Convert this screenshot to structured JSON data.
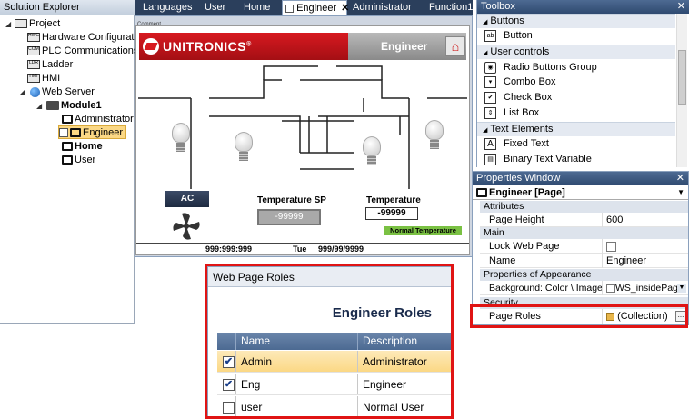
{
  "solution_explorer": {
    "title": "Solution Explorer",
    "items": [
      {
        "label": "Project",
        "icon": "project-icon"
      },
      {
        "label": "Hardware Configuratio",
        "icon": "hardware-config-icon"
      },
      {
        "label": "PLC Communications",
        "icon": "plc-comm-icon"
      },
      {
        "label": "Ladder",
        "icon": "ladder-icon"
      },
      {
        "label": "HMI",
        "icon": "hmi-icon"
      },
      {
        "label": "Web Server",
        "icon": "globe-icon"
      },
      {
        "label": "Module1",
        "icon": "folder-icon"
      },
      {
        "label": "Administrator",
        "icon": "monitor-icon"
      },
      {
        "label": "Engineer",
        "icon": "monitor-icon"
      },
      {
        "label": "Home",
        "icon": "monitor-icon"
      },
      {
        "label": "User",
        "icon": "monitor-icon"
      }
    ],
    "icon_text": {
      "hw": "HWC",
      "plc": "COM",
      "ladder": "LDR",
      "hmi": "HMI"
    }
  },
  "tabs": [
    {
      "label": "Languages"
    },
    {
      "label": "User"
    },
    {
      "label": "Home"
    },
    {
      "label": "Engineer",
      "active": true
    },
    {
      "label": "Administrator"
    },
    {
      "label": "Function1"
    }
  ],
  "designer": {
    "comment_label": "Comment",
    "brand": "UNITRONICS",
    "brand_mark": "®",
    "page_title": "Engineer",
    "ac_button": "AC",
    "temp_sp_label": "Temperature SP",
    "temp_sp_value": "-99999",
    "temp_label": "Temperature",
    "temp_value": "-99999",
    "normal_temp": "Normal Temperature",
    "status_time": "999:999:999",
    "status_day": "Tue",
    "status_date": "999/99/9999"
  },
  "toolbox": {
    "title": "Toolbox",
    "categories": [
      {
        "label": "Buttons",
        "items": [
          {
            "label": "Button",
            "icon": "button-icon",
            "glyph": "ab"
          }
        ]
      },
      {
        "label": "User controls",
        "items": [
          {
            "label": "Radio Buttons Group",
            "icon": "radio-group-icon"
          },
          {
            "label": "Combo Box",
            "icon": "combo-box-icon"
          },
          {
            "label": "Check Box",
            "icon": "check-box-icon"
          },
          {
            "label": "List Box",
            "icon": "list-box-icon"
          }
        ]
      },
      {
        "label": "Text Elements",
        "items": [
          {
            "label": "Fixed Text",
            "icon": "fixed-text-icon",
            "glyph": "A"
          },
          {
            "label": "Binary Text Variable",
            "icon": "binary-text-icon"
          }
        ]
      }
    ]
  },
  "properties": {
    "title": "Properties Window",
    "selected": "Engineer [Page]",
    "categories": {
      "attributes": "Attributes",
      "main": "Main",
      "appearance": "Properties of Appearance",
      "security": "Security"
    },
    "rows": {
      "page_height": {
        "name": "Page Height",
        "value": "600"
      },
      "lock_web_page": {
        "name": "Lock Web Page",
        "value": false
      },
      "name": {
        "name": "Name",
        "value": "Engineer"
      },
      "background": {
        "name": "Background: Color \\ Image",
        "value": "WS_insidePage"
      },
      "page_roles": {
        "name": "Page Roles",
        "value": "(Collection)",
        "button": "..."
      }
    }
  },
  "roles_dialog": {
    "title": "Web Page Roles",
    "heading": "Engineer Roles",
    "columns": [
      "Name",
      "Description"
    ],
    "rows": [
      {
        "name": "Admin",
        "description": "Administrator",
        "checked": true,
        "selected": true
      },
      {
        "name": "Eng",
        "description": "Engineer",
        "checked": true,
        "selected": false
      },
      {
        "name": "user",
        "description": "Normal User",
        "checked": false,
        "selected": false
      }
    ],
    "check_glyph": "✔"
  },
  "colors": {
    "highlight": "#e01414",
    "brand_red": "#d71920",
    "tab_bar": "#2b3f5c",
    "selection": "#fbd885"
  }
}
